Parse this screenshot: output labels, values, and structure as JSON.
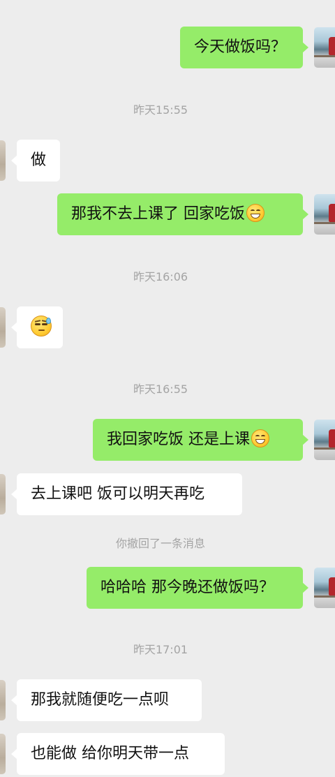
{
  "messages": [
    {
      "side": "out",
      "text": "今天做饭吗？"
    },
    {
      "type": "time",
      "text": "昨天15:55"
    },
    {
      "side": "in",
      "text": "做"
    },
    {
      "side": "out",
      "text": "那我不去上课了 回家吃饭",
      "emoji": "grinning-face"
    },
    {
      "type": "time",
      "text": "昨天16:06"
    },
    {
      "side": "in",
      "emoji": "sweat-face"
    },
    {
      "type": "time",
      "text": "昨天16:55"
    },
    {
      "side": "out",
      "text": "我回家吃饭 还是上课",
      "emoji": "grinning-face"
    },
    {
      "side": "in",
      "text": "去上课吧 饭可以明天再吃"
    },
    {
      "type": "notice",
      "text": "你撤回了一条消息"
    },
    {
      "side": "out",
      "text": "哈哈哈 那今晚还做饭吗？"
    },
    {
      "type": "time",
      "text": "昨天17:01"
    },
    {
      "side": "in",
      "text": "那我就随便吃一点呗"
    },
    {
      "side": "in",
      "text": "也能做 给你明天带一点"
    }
  ],
  "colors": {
    "background": "#ededed",
    "outgoing_bubble": "#95ec69",
    "incoming_bubble": "#ffffff",
    "timestamp_text": "#a4a4a4"
  }
}
